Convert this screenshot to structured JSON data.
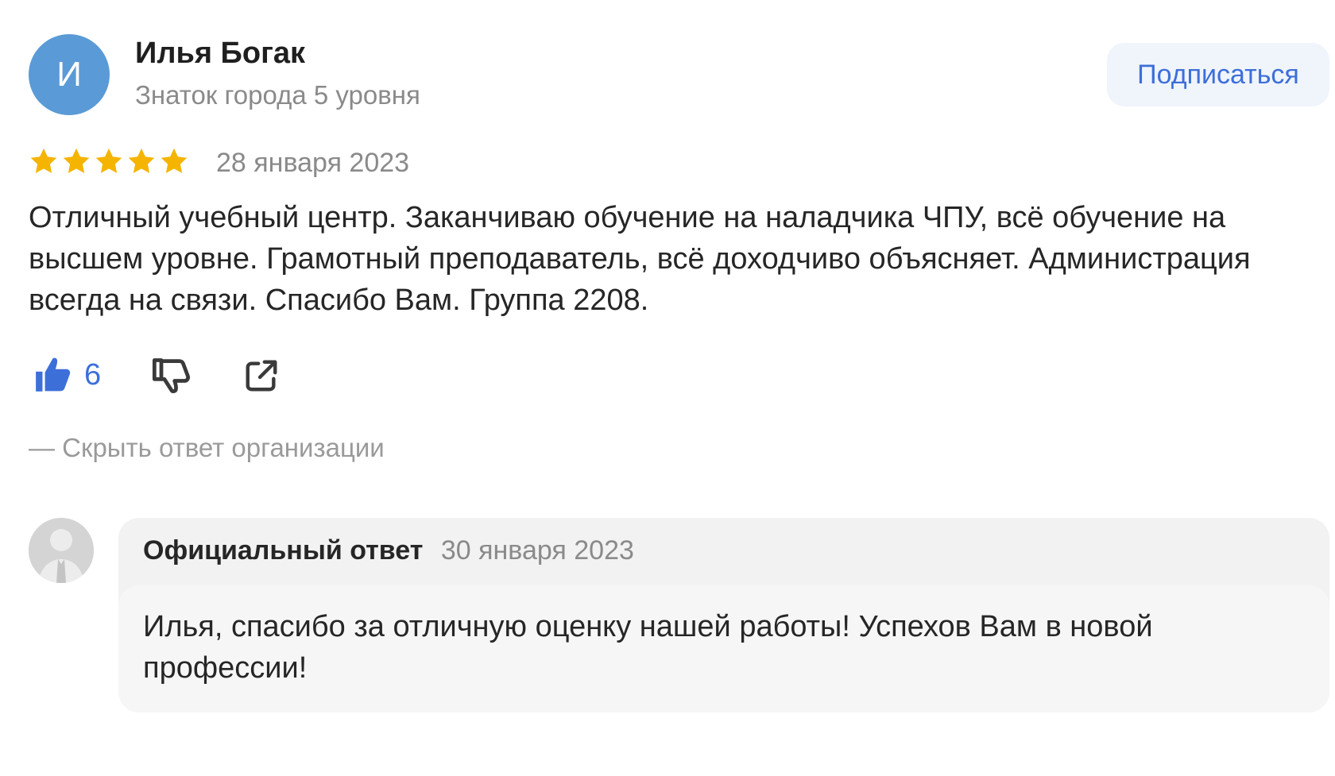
{
  "author": {
    "initial": "И",
    "name": "Илья Богак",
    "level": "Знаток города 5 уровня",
    "avatar_color": "#5a9ad6"
  },
  "subscribe_label": "Подписаться",
  "review": {
    "rating": 5,
    "rating_max": 5,
    "date": "28 января 2023",
    "text": "Отличный учебный центр. Заканчиваю обучение на наладчика ЧПУ, всё обучение на высшем уровне. Грамотный преподаватель, всё доходчиво объясняет. Администрация всегда на связи. Спасибо Вам. Группа 2208."
  },
  "actions": {
    "like_icon": "thumbs-up-icon",
    "like_count": "6",
    "dislike_icon": "thumbs-down-icon",
    "share_icon": "share-icon"
  },
  "hide_reply_label": "—  Скрыть ответ организации",
  "reply": {
    "avatar_icon": "person-silhouette-icon",
    "title": "Официальный ответ",
    "date": "30 января 2023",
    "text": "Илья, спасибо за отличную оценку нашей работы! Успехов Вам в новой профессии!"
  },
  "colors": {
    "accent": "#3d6fd9",
    "star": "#f5b400",
    "muted": "#8a8a8a"
  }
}
